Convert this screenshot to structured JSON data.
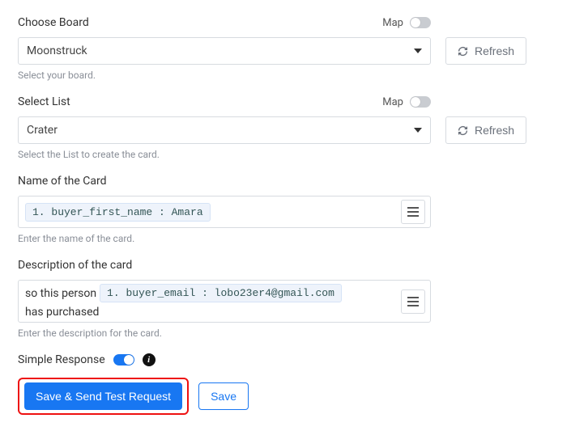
{
  "board": {
    "label": "Choose Board",
    "map_label": "Map",
    "map_on": false,
    "value": "Moonstruck",
    "refresh": "Refresh",
    "help": "Select your board."
  },
  "list": {
    "label": "Select List",
    "map_label": "Map",
    "map_on": false,
    "value": "Crater",
    "refresh": "Refresh",
    "help": "Select the List to create the card."
  },
  "name": {
    "label": "Name of the Card",
    "pill": "1. buyer_first_name : Amara",
    "help": "Enter the name of the card."
  },
  "desc": {
    "label": "Description of the card",
    "text_before": "so this person",
    "pill": "1. buyer_email : lobo23er4@gmail.com",
    "text_after": "has purchased",
    "help": "Enter the description for the card."
  },
  "simple": {
    "label": "Simple Response",
    "on": true
  },
  "buttons": {
    "primary": "Save & Send Test Request",
    "secondary": "Save"
  }
}
